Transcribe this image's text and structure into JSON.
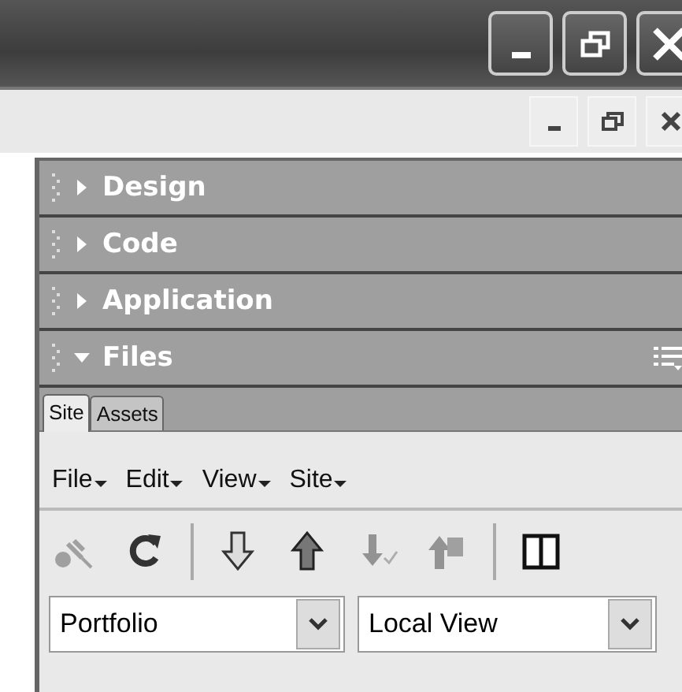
{
  "panels": [
    {
      "title": "Design",
      "expanded": false
    },
    {
      "title": "Code",
      "expanded": false
    },
    {
      "title": "Application",
      "expanded": false
    },
    {
      "title": "Files",
      "expanded": true
    }
  ],
  "files": {
    "tabs": [
      {
        "label": "Site",
        "selected": true
      },
      {
        "label": "Assets",
        "selected": false
      }
    ],
    "menus": [
      {
        "label": "File"
      },
      {
        "label": "Edit"
      },
      {
        "label": "View"
      },
      {
        "label": "Site"
      }
    ],
    "toolbar": [
      {
        "kind": "connect",
        "disabled": true
      },
      {
        "kind": "refresh",
        "disabled": false
      },
      {
        "kind": "separator"
      },
      {
        "kind": "get",
        "disabled": false
      },
      {
        "kind": "put",
        "disabled": false
      },
      {
        "kind": "checkout",
        "disabled": true
      },
      {
        "kind": "checkin",
        "disabled": true
      },
      {
        "kind": "separator"
      },
      {
        "kind": "expand",
        "disabled": false
      }
    ],
    "site_select": {
      "value": "Portfolio"
    },
    "view_select": {
      "value": "Local View"
    }
  }
}
